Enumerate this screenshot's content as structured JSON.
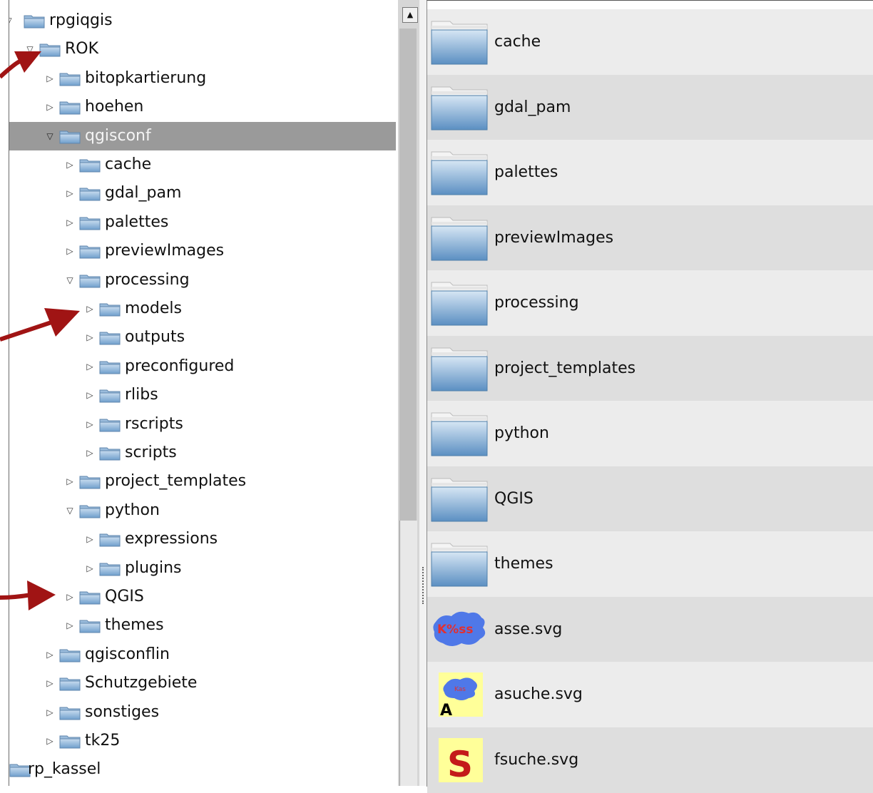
{
  "tree": {
    "items": [
      {
        "label": "rpgiqgis",
        "level": 0,
        "expanded": true,
        "selected": false
      },
      {
        "label": "ROK",
        "level": 1,
        "expanded": true,
        "selected": false
      },
      {
        "label": "bitopkartierung",
        "level": 2,
        "expanded": false,
        "selected": false
      },
      {
        "label": "hoehen",
        "level": 2,
        "expanded": false,
        "selected": false
      },
      {
        "label": "qgisconf",
        "level": 2,
        "expanded": true,
        "selected": true
      },
      {
        "label": "cache",
        "level": 3,
        "expanded": false,
        "selected": false
      },
      {
        "label": "gdal_pam",
        "level": 3,
        "expanded": false,
        "selected": false
      },
      {
        "label": "palettes",
        "level": 3,
        "expanded": false,
        "selected": false
      },
      {
        "label": "previewImages",
        "level": 3,
        "expanded": false,
        "selected": false
      },
      {
        "label": "processing",
        "level": 3,
        "expanded": true,
        "selected": false
      },
      {
        "label": "models",
        "level": 4,
        "expanded": false,
        "selected": false
      },
      {
        "label": "outputs",
        "level": 4,
        "expanded": false,
        "selected": false
      },
      {
        "label": "preconfigured",
        "level": 4,
        "expanded": false,
        "selected": false
      },
      {
        "label": "rlibs",
        "level": 4,
        "expanded": false,
        "selected": false
      },
      {
        "label": "rscripts",
        "level": 4,
        "expanded": false,
        "selected": false
      },
      {
        "label": "scripts",
        "level": 4,
        "expanded": false,
        "selected": false
      },
      {
        "label": "project_templates",
        "level": 3,
        "expanded": false,
        "selected": false
      },
      {
        "label": "python",
        "level": 3,
        "expanded": true,
        "selected": false
      },
      {
        "label": "expressions",
        "level": 4,
        "expanded": false,
        "selected": false
      },
      {
        "label": "plugins",
        "level": 4,
        "expanded": false,
        "selected": false
      },
      {
        "label": "QGIS",
        "level": 3,
        "expanded": false,
        "selected": false
      },
      {
        "label": "themes",
        "level": 3,
        "expanded": false,
        "selected": false
      },
      {
        "label": "qgisconflin",
        "level": 2,
        "expanded": false,
        "selected": false
      },
      {
        "label": "Schutzgebiete",
        "level": 2,
        "expanded": false,
        "selected": false
      },
      {
        "label": "sonstiges",
        "level": 2,
        "expanded": false,
        "selected": false
      },
      {
        "label": "tk25",
        "level": 2,
        "expanded": false,
        "selected": false
      },
      {
        "label": "rp_kassel",
        "level": 0,
        "expanded": null,
        "selected": false
      }
    ]
  },
  "scrollbar": {
    "up_icon": "arrow-up-icon"
  },
  "files": [
    {
      "name": "cache",
      "kind": "folder"
    },
    {
      "name": "gdal_pam",
      "kind": "folder"
    },
    {
      "name": "palettes",
      "kind": "folder"
    },
    {
      "name": "previewImages",
      "kind": "folder"
    },
    {
      "name": "processing",
      "kind": "folder"
    },
    {
      "name": "project_templates",
      "kind": "folder"
    },
    {
      "name": "python",
      "kind": "folder"
    },
    {
      "name": "QGIS",
      "kind": "folder"
    },
    {
      "name": "themes",
      "kind": "folder"
    },
    {
      "name": "asse.svg",
      "kind": "svg-map",
      "icon_text": "K%ss"
    },
    {
      "name": "asuche.svg",
      "kind": "svg-search-map",
      "icon_text": "Kas",
      "icon_letter": "A"
    },
    {
      "name": "fsuche.svg",
      "kind": "svg-letter",
      "icon_letter": "S"
    }
  ],
  "colors": {
    "selection": "#9a9a9a",
    "folder_blue": "#8fb8dd",
    "annotation_arrow": "#a01414",
    "svg_icon_yellow": "#ffff99"
  }
}
